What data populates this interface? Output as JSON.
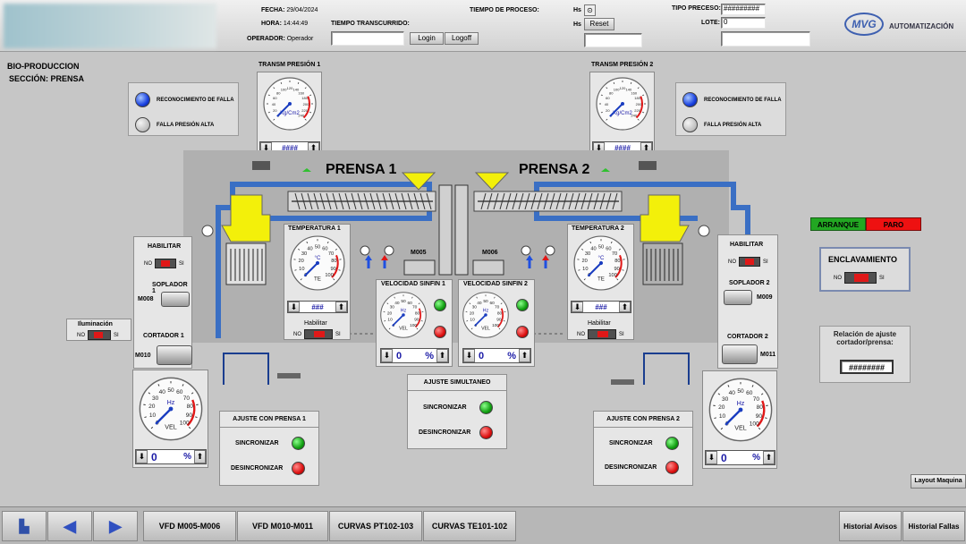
{
  "header": {
    "fecha_label": "FECHA:",
    "fecha_value": "29/04/2024",
    "hora_label": "HORA:",
    "hora_value": "14:44:49",
    "operador_label": "OPERADOR:",
    "operador_value": "Operador",
    "tiempo_transcurrido_label": "TIEMPO TRANSCURRIDO:",
    "tiempo_proceso_label": "TIEMPO DE PROCESO:",
    "hs_label_1": "Hs",
    "hs_label_2": "Hs",
    "reset_label": "Reset",
    "login_label": "Login",
    "logoff_label": "Logoff",
    "tipo_preceso_label": "TIPO PRECESO:",
    "tipo_preceso_value": "#########",
    "lote_label": "LOTE:",
    "lote_value": "0",
    "brand": "AUTOMATIZACIÓN",
    "logo_text": "MVG"
  },
  "section": {
    "line1": "BIO-PRODUCCION",
    "line2": "SECCIÓN: PRENSA"
  },
  "alarms_left": {
    "falla_label": "RECONOCIMIENTO DE FALLA",
    "presion_label": "FALLA PRESIÓN ALTA"
  },
  "alarms_right": {
    "falla_label": "RECONOCIMIENTO DE FALLA",
    "presion_label": "FALLA PRESIÓN ALTA"
  },
  "pressure1": {
    "title": "TRANSM PRESIÓN 1",
    "unit": "Kg/Cm2",
    "value": "####"
  },
  "pressure2": {
    "title": "TRANSM PRESIÓN 2",
    "unit": "Kg/Cm2",
    "value": "####"
  },
  "press1_title": "PRENSA 1",
  "press2_title": "PRENSA 2",
  "motors": {
    "m005": "M005",
    "m006": "M006",
    "m008": "M008",
    "m009": "M009",
    "m010": "M010",
    "m011": "M011"
  },
  "temp1": {
    "title": "TEMPERATURA 1",
    "unit": "°C",
    "label": "TE",
    "value": "###",
    "habilitar": "Habilitar"
  },
  "temp2": {
    "title": "TEMPERATURA 2",
    "unit": "°C",
    "label": "TE",
    "value": "###",
    "habilitar": "Habilitar"
  },
  "sinfin1": {
    "title": "VELOCIDAD SINFIN 1",
    "unit": "Hz",
    "label": "VEL",
    "value": "0",
    "pct": "%"
  },
  "sinfin2": {
    "title": "VELOCIDAD SINFIN 2",
    "unit": "Hz",
    "label": "VEL",
    "value": "0",
    "pct": "%"
  },
  "vel_left": {
    "unit": "Hz",
    "label": "VEL",
    "value": "0",
    "pct": "%"
  },
  "vel_right": {
    "unit": "Hz",
    "label": "VEL",
    "value": "0",
    "pct": "%"
  },
  "left_panel": {
    "habilitar": "HABILITAR",
    "soplador": "SOPLADOR 1",
    "cortador": "CORTADOR 1"
  },
  "right_panel": {
    "habilitar": "HABILITAR",
    "soplador": "SOPLADOR 2",
    "cortador": "CORTADOR 2"
  },
  "iluminacion": "Iluminación",
  "toggle": {
    "no": "NO",
    "si": "SI"
  },
  "ajuste1": {
    "title": "AJUSTE CON PRENSA 1",
    "sync": "SINCRONIZAR",
    "desync": "DESINCRONIZAR"
  },
  "ajuste2": {
    "title": "AJUSTE CON PRENSA 2",
    "sync": "SINCRONIZAR",
    "desync": "DESINCRONIZAR"
  },
  "ajuste_sim": {
    "title": "AJUSTE SIMULTANEO",
    "sync": "SINCRONIZAR",
    "desync": "DESINCRONIZAR"
  },
  "controls": {
    "arranque": "ARRANQUE",
    "paro": "PARO",
    "enclavamiento": "ENCLAVAMIENTO"
  },
  "relacion": {
    "title": "Relación de ajuste cortador/prensa:",
    "value": "########"
  },
  "layout_maquina": "Layout Maquina",
  "gauge_ticks": {
    "pressure": [
      "0",
      "20",
      "40",
      "60",
      "80",
      "100",
      "120",
      "140",
      "160",
      "180",
      "200",
      "220",
      "240"
    ],
    "temp": [
      "0",
      "10",
      "20",
      "30",
      "40",
      "50",
      "60",
      "70",
      "80",
      "90",
      "100"
    ],
    "hz": [
      "0",
      "10",
      "20",
      "30",
      "40",
      "50",
      "60",
      "70",
      "80",
      "90",
      "100"
    ]
  },
  "footer": {
    "tabs": [
      "VFD M005-M006",
      "VFD M010-M011",
      "CURVAS PT102-103",
      "CURVAS TE101-102"
    ],
    "historial_avisos": "Historial Avisos",
    "historial_fallas": "Historial Fallas"
  },
  "colors": {
    "arranque": "#22a722",
    "paro": "#ee1111",
    "pipe": "#3a6fc4",
    "hopper": "#f3f00a"
  }
}
